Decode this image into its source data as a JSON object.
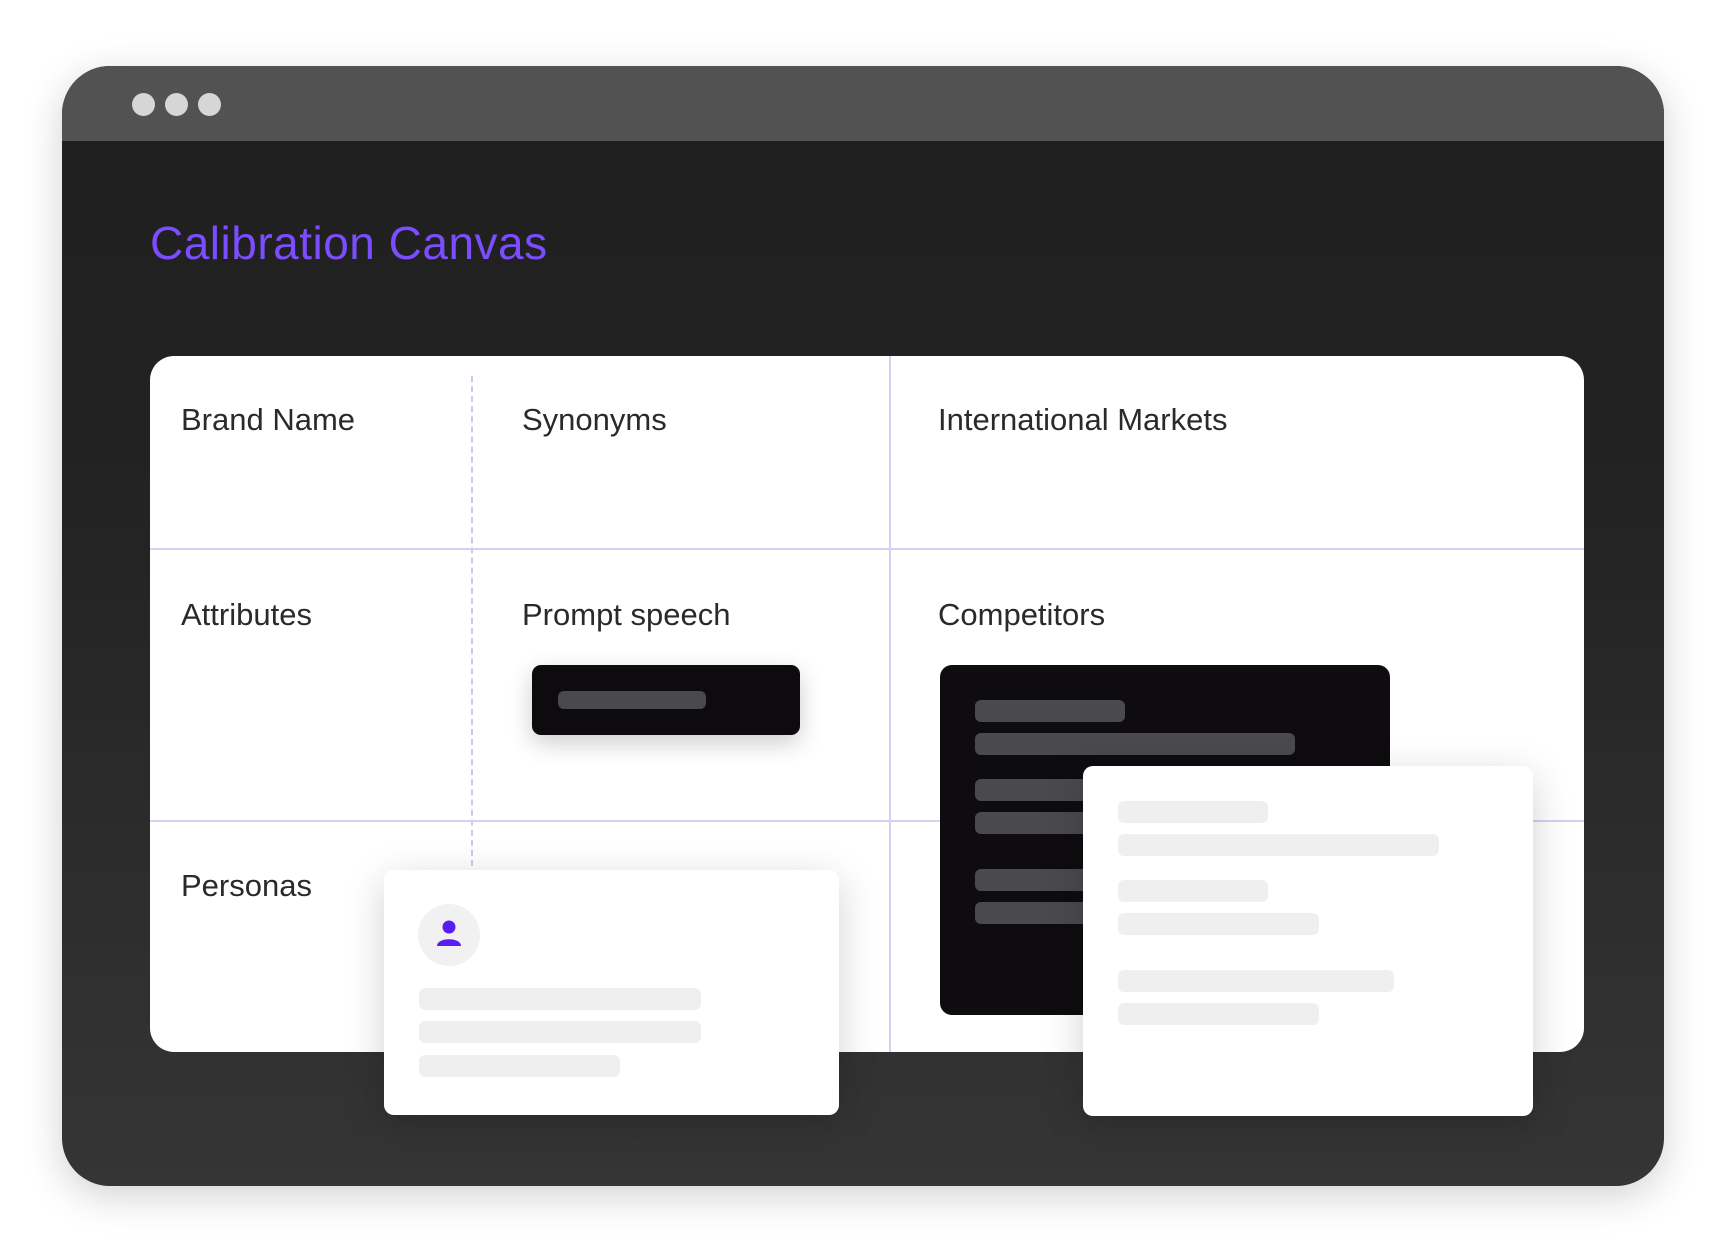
{
  "page_title": "Calibration Canvas",
  "colors": {
    "accent": "#7b4dff",
    "window_frame": "#525252",
    "window_background": "#1f1f1f",
    "canvas_background": "#ffffff",
    "grid_line": "#d8d0f2",
    "dark_card": "#0e0c0f",
    "placeholder_dark": "#4a4a4e",
    "placeholder_light": "#efefef"
  },
  "window_controls": [
    "window-dot",
    "window-dot",
    "window-dot"
  ],
  "canvas": {
    "cells": {
      "brand_name": "Brand Name",
      "synonyms": "Synonyms",
      "international_markets": "International Markets",
      "attributes": "Attributes",
      "prompt_speech": "Prompt speech",
      "competitors": "Competitors",
      "personas": "Personas"
    }
  },
  "icons": {
    "persona_avatar": "user-icon"
  }
}
